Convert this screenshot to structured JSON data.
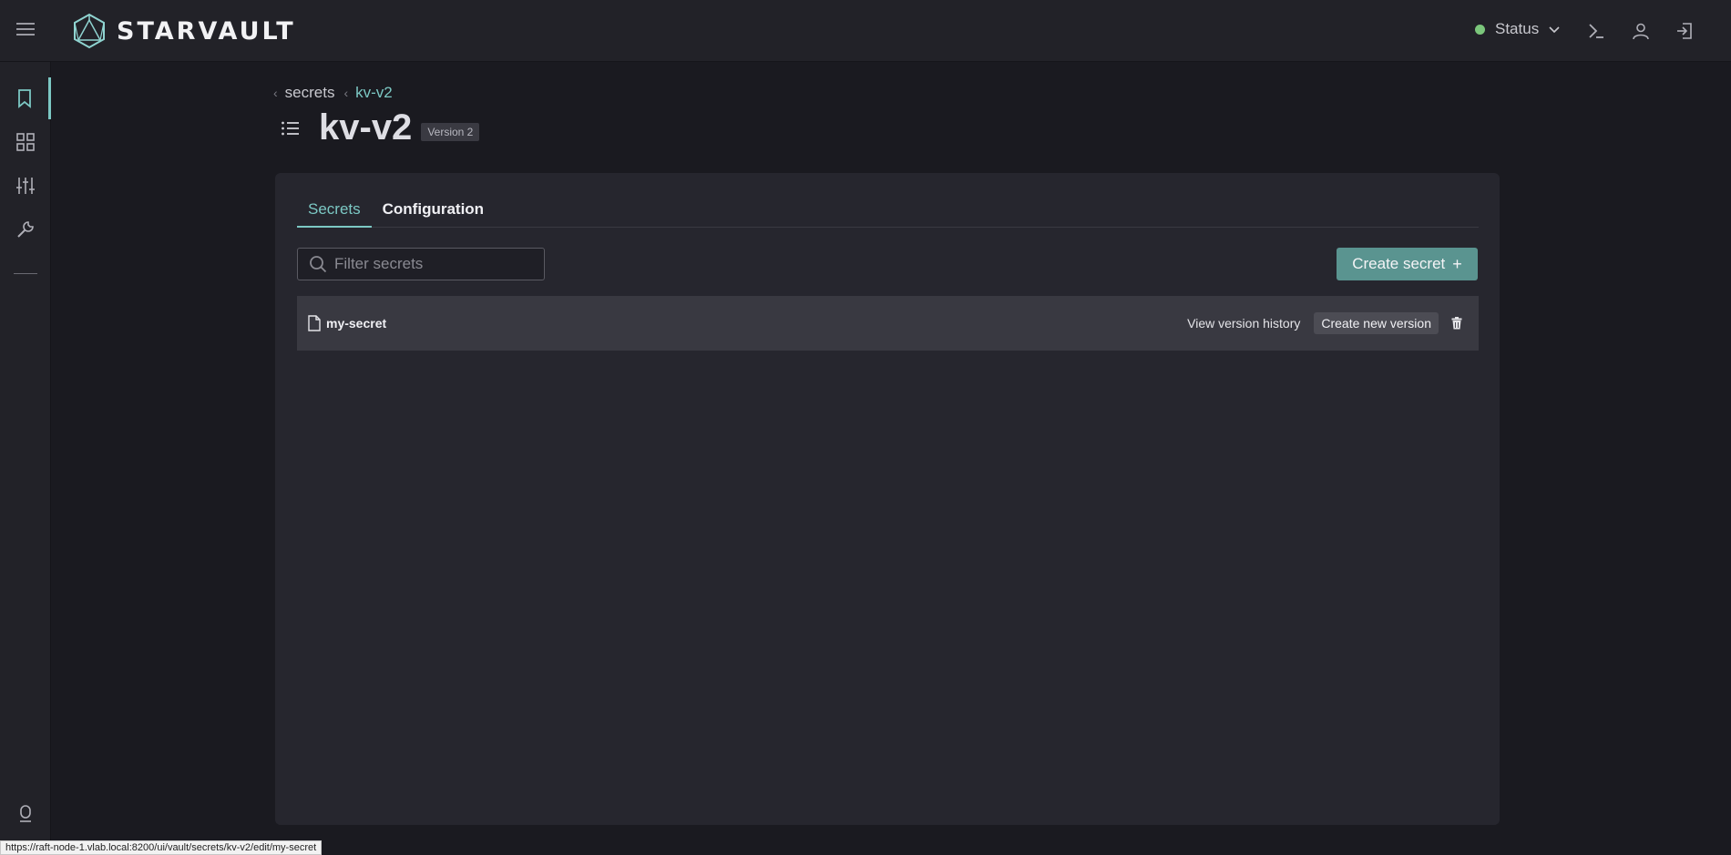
{
  "app": {
    "name": "STARVAULT"
  },
  "header": {
    "status_label": "Status",
    "status_color": "#7bc67b"
  },
  "sidebar": {
    "items": [
      {
        "icon": "bookmark-icon",
        "active": true
      },
      {
        "icon": "dashboard-grid-icon",
        "active": false
      },
      {
        "icon": "sliders-icon",
        "active": false
      },
      {
        "icon": "wrench-icon",
        "active": false
      }
    ]
  },
  "breadcrumb": {
    "items": [
      "secrets",
      "kv-v2"
    ]
  },
  "page": {
    "title": "kv-v2",
    "version_badge": "Version 2"
  },
  "tabs": [
    {
      "label": "Secrets",
      "active": true
    },
    {
      "label": "Configuration",
      "active": false
    }
  ],
  "filter": {
    "placeholder": "Filter secrets"
  },
  "create_button": {
    "label": "Create secret"
  },
  "secrets": [
    {
      "name": "my-secret",
      "history_label": "View version history",
      "new_version_label": "Create new version"
    }
  ],
  "statusbar": {
    "url": "https://raft-node-1.vlab.local:8200/ui/vault/secrets/kv-v2/edit/my-secret"
  },
  "colors": {
    "accent": "#7cc8c4",
    "primary_button": "#5a9490"
  }
}
